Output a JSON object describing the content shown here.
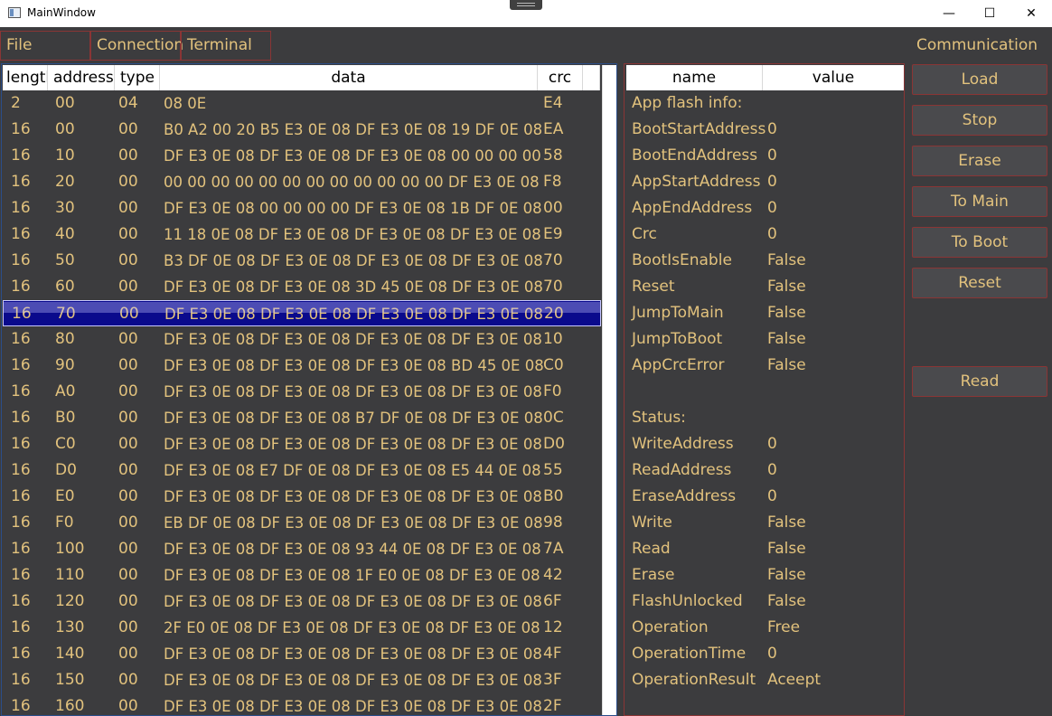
{
  "window": {
    "title": "MainWindow",
    "minimize": "—",
    "maximize": "☐",
    "close": "✕"
  },
  "menu": {
    "file": "File",
    "connection": "Connection",
    "terminal": "Terminal"
  },
  "communication_label": "Communication",
  "hex_table": {
    "headers": {
      "length": "length",
      "address": "address",
      "type": "type",
      "data": "data",
      "crc": "crc"
    },
    "selected_row": 8,
    "rows": [
      {
        "length": "2",
        "address": "00",
        "type": "04",
        "data": "08 0E",
        "crc": "E4"
      },
      {
        "length": "16",
        "address": "00",
        "type": "00",
        "data": "B0 A2 00 20 B5 E3 0E 08 DF E3 0E 08 19 DF 0E 08",
        "crc": "EA"
      },
      {
        "length": "16",
        "address": "10",
        "type": "00",
        "data": "DF E3 0E 08 DF E3 0E 08 DF E3 0E 08 00 00 00 00",
        "crc": "58"
      },
      {
        "length": "16",
        "address": "20",
        "type": "00",
        "data": "00 00 00 00 00 00 00 00 00 00 00 00 DF E3 0E 08",
        "crc": "F8"
      },
      {
        "length": "16",
        "address": "30",
        "type": "00",
        "data": "DF E3 0E 08 00 00 00 00 DF E3 0E 08 1B DF 0E 08",
        "crc": "00"
      },
      {
        "length": "16",
        "address": "40",
        "type": "00",
        "data": "11 18 0E 08 DF E3 0E 08 DF E3 0E 08 DF E3 0E 08",
        "crc": "E9"
      },
      {
        "length": "16",
        "address": "50",
        "type": "00",
        "data": "B3 DF 0E 08 DF E3 0E 08 DF E3 0E 08 DF E3 0E 08",
        "crc": "70"
      },
      {
        "length": "16",
        "address": "60",
        "type": "00",
        "data": "DF E3 0E 08 DF E3 0E 08 3D 45 0E 08 DF E3 0E 08",
        "crc": "70"
      },
      {
        "length": "16",
        "address": "70",
        "type": "00",
        "data": "DF E3 0E 08 DF E3 0E 08 DF E3 0E 08 DF E3 0E 08",
        "crc": "20"
      },
      {
        "length": "16",
        "address": "80",
        "type": "00",
        "data": "DF E3 0E 08 DF E3 0E 08 DF E3 0E 08 DF E3 0E 08",
        "crc": "10"
      },
      {
        "length": "16",
        "address": "90",
        "type": "00",
        "data": "DF E3 0E 08 DF E3 0E 08 DF E3 0E 08 BD 45 0E 08",
        "crc": "C0"
      },
      {
        "length": "16",
        "address": "A0",
        "type": "00",
        "data": "DF E3 0E 08 DF E3 0E 08 DF E3 0E 08 DF E3 0E 08",
        "crc": "F0"
      },
      {
        "length": "16",
        "address": "B0",
        "type": "00",
        "data": "DF E3 0E 08 DF E3 0E 08 B7 DF 0E 08 DF E3 0E 08",
        "crc": "0C"
      },
      {
        "length": "16",
        "address": "C0",
        "type": "00",
        "data": "DF E3 0E 08 DF E3 0E 08 DF E3 0E 08 DF E3 0E 08",
        "crc": "D0"
      },
      {
        "length": "16",
        "address": "D0",
        "type": "00",
        "data": "DF E3 0E 08 E7 DF 0E 08 DF E3 0E 08 E5 44 0E 08",
        "crc": "55"
      },
      {
        "length": "16",
        "address": "E0",
        "type": "00",
        "data": "DF E3 0E 08 DF E3 0E 08 DF E3 0E 08 DF E3 0E 08",
        "crc": "B0"
      },
      {
        "length": "16",
        "address": "F0",
        "type": "00",
        "data": "EB DF 0E 08 DF E3 0E 08 DF E3 0E 08 DF E3 0E 08",
        "crc": "98"
      },
      {
        "length": "16",
        "address": "100",
        "type": "00",
        "data": "DF E3 0E 08 DF E3 0E 08 93 44 0E 08 DF E3 0E 08",
        "crc": "7A"
      },
      {
        "length": "16",
        "address": "110",
        "type": "00",
        "data": "DF E3 0E 08 DF E3 0E 08 1F E0 0E 08 DF E3 0E 08",
        "crc": "42"
      },
      {
        "length": "16",
        "address": "120",
        "type": "00",
        "data": "DF E3 0E 08 DF E3 0E 08 DF E3 0E 08 DF E3 0E 08",
        "crc": "6F"
      },
      {
        "length": "16",
        "address": "130",
        "type": "00",
        "data": "2F E0 0E 08 DF E3 0E 08 DF E3 0E 08 DF E3 0E 08",
        "crc": "12"
      },
      {
        "length": "16",
        "address": "140",
        "type": "00",
        "data": "DF E3 0E 08 DF E3 0E 08 DF E3 0E 08 DF E3 0E 08",
        "crc": "4F"
      },
      {
        "length": "16",
        "address": "150",
        "type": "00",
        "data": "DF E3 0E 08 DF E3 0E 08 DF E3 0E 08 DF E3 0E 08",
        "crc": "3F"
      },
      {
        "length": "16",
        "address": "160",
        "type": "00",
        "data": "DF E3 0E 08 DF E3 0E 08 DF E3 0E 08 DF E3 0E 08",
        "crc": "2F"
      }
    ]
  },
  "info_table": {
    "headers": {
      "name": "name",
      "value": "value"
    },
    "rows": [
      {
        "name": "App flash info:",
        "value": ""
      },
      {
        "name": "BootStartAddress",
        "value": "0"
      },
      {
        "name": "BootEndAddress",
        "value": "0"
      },
      {
        "name": "AppStartAddress",
        "value": "0"
      },
      {
        "name": "AppEndAddress",
        "value": "0"
      },
      {
        "name": "Crc",
        "value": "0"
      },
      {
        "name": "BootIsEnable",
        "value": "False"
      },
      {
        "name": "Reset",
        "value": "False"
      },
      {
        "name": "JumpToMain",
        "value": "False"
      },
      {
        "name": "JumpToBoot",
        "value": "False"
      },
      {
        "name": "AppCrcError",
        "value": "False"
      },
      {
        "name": "",
        "value": ""
      },
      {
        "name": "Status:",
        "value": ""
      },
      {
        "name": "WriteAddress",
        "value": "0"
      },
      {
        "name": "ReadAddress",
        "value": "0"
      },
      {
        "name": "EraseAddress",
        "value": "0"
      },
      {
        "name": "Write",
        "value": "False"
      },
      {
        "name": "Read",
        "value": "False"
      },
      {
        "name": "Erase",
        "value": "False"
      },
      {
        "name": "FlashUnlocked",
        "value": "False"
      },
      {
        "name": "Operation",
        "value": "Free"
      },
      {
        "name": "OperationTime",
        "value": "0"
      },
      {
        "name": "OperationResult",
        "value": "Aceept"
      }
    ]
  },
  "buttons": {
    "load": "Load",
    "stop": "Stop",
    "erase": "Erase",
    "to_main": "To Main",
    "to_boot": "To Boot",
    "reset": "Reset",
    "read": "Read"
  },
  "colors": {
    "text": "#e2c27d",
    "background": "#3c3c3e",
    "border": "#8a3535",
    "selection": "#0a0a8c"
  }
}
